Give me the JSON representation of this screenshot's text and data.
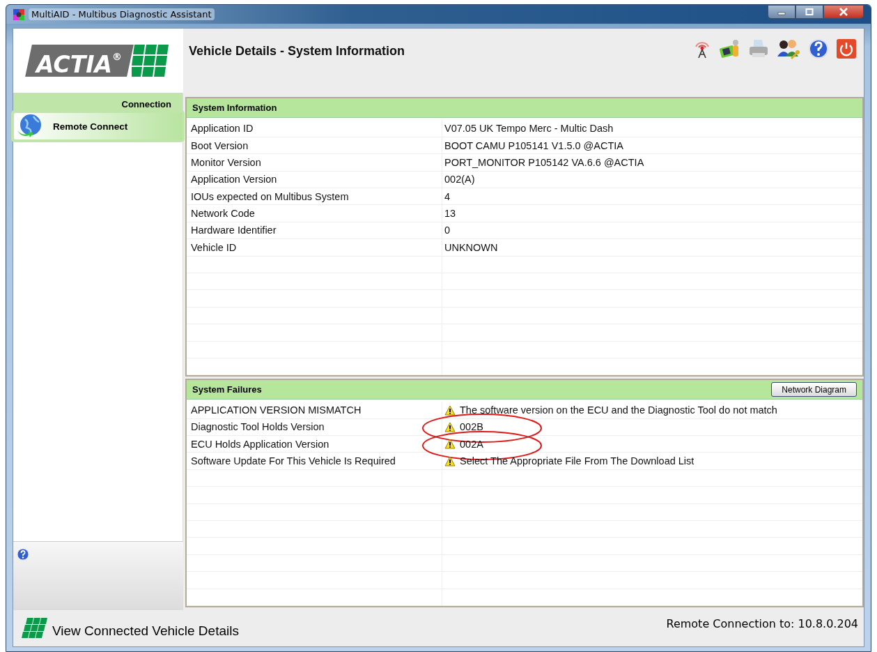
{
  "window": {
    "title": "MultiAID - Multibus Diagnostic Assistant"
  },
  "header": {
    "logo": "ACTIA$^{®}$",
    "title": "Vehicle Details - System Information"
  },
  "sidebar": {
    "section": "Connection",
    "items": [
      {
        "label": "Remote Connect",
        "selected": true
      }
    ]
  },
  "system_information": {
    "title": "System Information",
    "rows": [
      {
        "label": "Application ID",
        "value": "V07.05 UK Tempo Merc - Multic Dash"
      },
      {
        "label": "Boot Version",
        "value": "BOOT CAMU P105141 V1.5.0 @ACTIA"
      },
      {
        "label": "Monitor Version",
        "value": "PORT_MONITOR P105142 VA.6.6 @ACTIA"
      },
      {
        "label": "Application Version",
        "value": "002(A)"
      },
      {
        "label": "IOUs expected on Multibus System",
        "value": "4"
      },
      {
        "label": "Network Code",
        "value": "13"
      },
      {
        "label": "Hardware Identifier",
        "value": "0"
      },
      {
        "label": "Vehicle ID",
        "value": "UNKNOWN"
      }
    ]
  },
  "system_failures": {
    "title": "System Failures",
    "button": "Network Diagram",
    "rows": [
      {
        "label": "APPLICATION VERSION MISMATCH",
        "value": "The software version on the ECU and the Diagnostic Tool do not match",
        "circled": false
      },
      {
        "label": "Diagnostic Tool Holds Version",
        "value": "002B",
        "circled": true
      },
      {
        "label": "ECU Holds Application Version",
        "value": "002A",
        "circled": true
      },
      {
        "label": "Software Update For This Vehicle Is Required",
        "value": "Select The Appropriate File From The Download List",
        "circled": false
      }
    ]
  },
  "status_bar": {
    "left": "View Connected Vehicle Details",
    "right": "Remote Connection to: 10.8.0.204"
  }
}
